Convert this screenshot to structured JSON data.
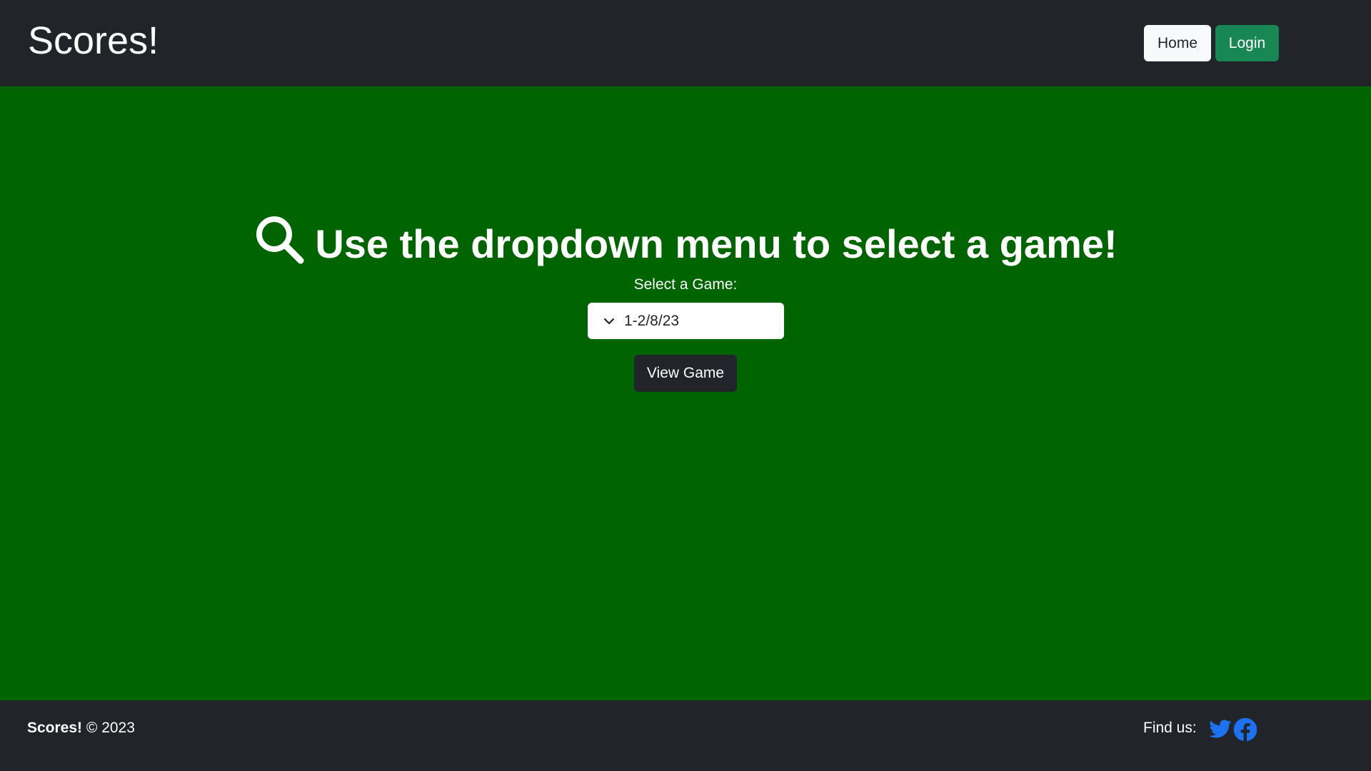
{
  "header": {
    "brand": "Scores!",
    "nav": {
      "home_label": "Home",
      "login_label": "Login"
    }
  },
  "main": {
    "headline": "Use the dropdown menu to select a game!",
    "select_label": "Select a Game:",
    "selected_game": "1-2/8/23",
    "view_button_label": "View Game"
  },
  "footer": {
    "brand": "Scores!",
    "copyright": "© 2023",
    "find_us": "Find us:"
  },
  "icons": {
    "headline_icon": "search-icon",
    "select_icon": "chevron-down-icon",
    "social": [
      "twitter-icon",
      "facebook-icon"
    ]
  },
  "colors": {
    "header_bg": "#212529",
    "main_bg": "#006400",
    "login_button": "#198754",
    "social_icon": "#1d72f3"
  }
}
